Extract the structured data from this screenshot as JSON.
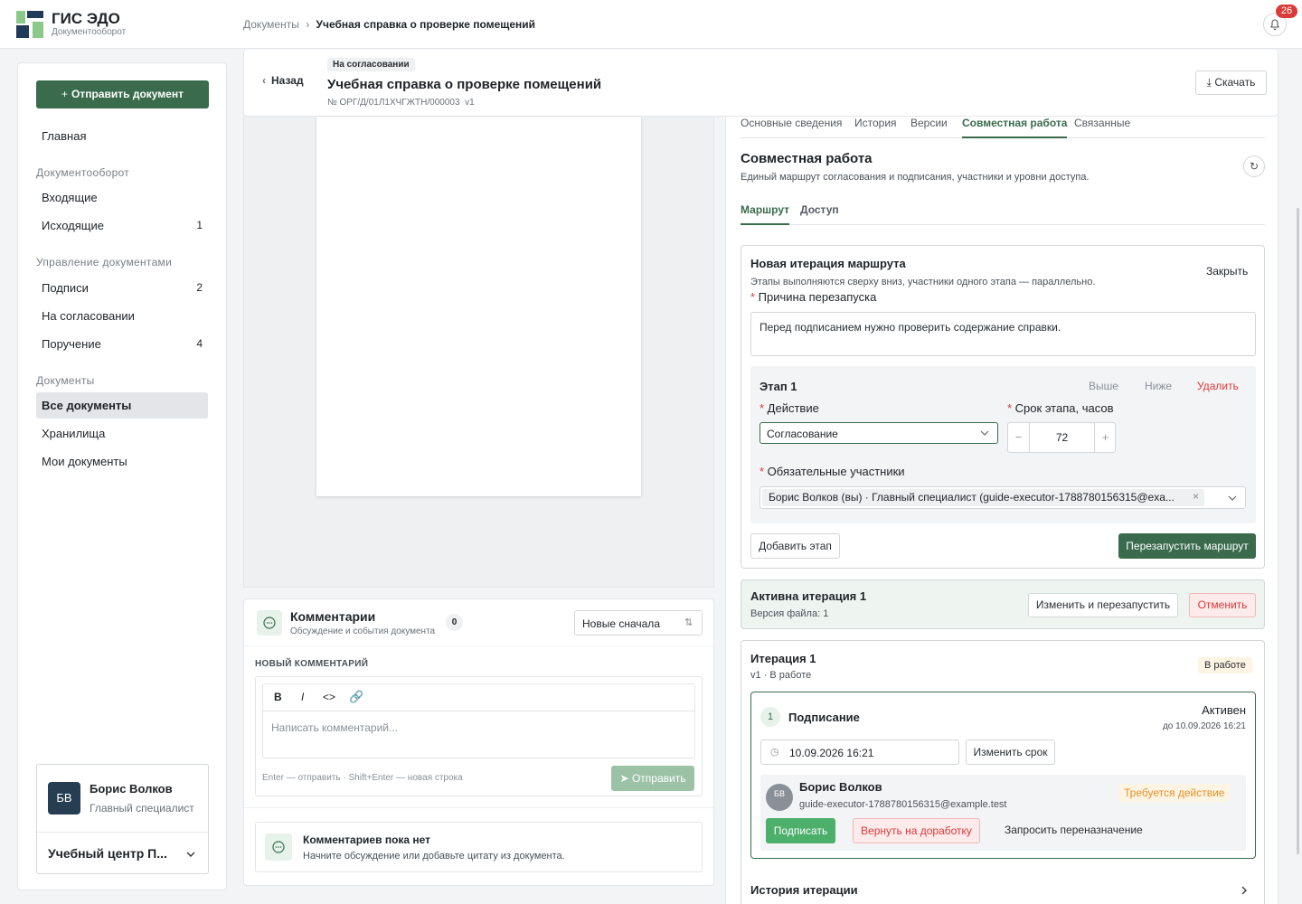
{
  "app": {
    "name": "ГИС ЭДО",
    "subtitle": "Документооборот"
  },
  "breadcrumb": {
    "root": "Документы",
    "separator": "›",
    "current": "Учебная справка о проверке помещений"
  },
  "notifications": {
    "count": "26"
  },
  "sidebar": {
    "send_button": "Отправить документ",
    "home": "Главная",
    "sections": [
      {
        "title": "Документооборот",
        "items": [
          {
            "label": "Входящие",
            "count": ""
          },
          {
            "label": "Исходящие",
            "count": "1"
          }
        ]
      },
      {
        "title": "Управление документами",
        "items": [
          {
            "label": "Подписи",
            "count": "2"
          },
          {
            "label": "На согласовании",
            "count": ""
          },
          {
            "label": "Поручение",
            "count": "4"
          }
        ]
      },
      {
        "title": "Документы",
        "items": [
          {
            "label": "Все документы",
            "count": ""
          },
          {
            "label": "Хранилища",
            "count": ""
          },
          {
            "label": "Мои документы",
            "count": ""
          }
        ]
      }
    ],
    "user": {
      "initials": "БВ",
      "name": "Борис Волков",
      "role": "Главный специалист"
    },
    "org": "Учебный центр П..."
  },
  "doc": {
    "back": "Назад",
    "status_badge": "На согласовании",
    "title": "Учебная справка о проверке помещений",
    "number": "№ ОРГ/Д/01Л1ХЧГЖТН/000003",
    "version": "v1",
    "download": "Скачать"
  },
  "tabs": [
    "Основные сведения",
    "История",
    "Версии",
    "Совместная работа",
    "Связанные"
  ],
  "collab": {
    "title": "Совместная работа",
    "desc": "Единый маршрут согласования и подписания, участники и уровни доступа.",
    "subtabs": [
      "Маршрут",
      "Доступ"
    ],
    "new_iter": {
      "title": "Новая итерация маршрута",
      "close": "Закрыть",
      "hint": "Этапы выполняются сверху вниз, участники одного этапа — параллельно.",
      "reason_label": "Причина перезапуска",
      "reason_value": "Перед подписанием нужно проверить содержание справки.",
      "stage_title": "Этап 1",
      "up": "Выше",
      "down": "Ниже",
      "delete": "Удалить",
      "action_label": "Действие",
      "action_value": "Согласование",
      "deadline_label": "Срок этапа, часов",
      "deadline_value": "72",
      "participants_label": "Обязательные участники",
      "participant": "Борис Волков (вы) · Главный специалист (guide-executor-1788780156315@exa...",
      "add_stage": "Добавить этап",
      "restart": "Перезапустить маршрут"
    },
    "active": {
      "title": "Активна итерация 1",
      "file_version": "Версия файла: 1",
      "edit_restart": "Изменить и перезапустить",
      "cancel": "Отменить"
    },
    "iteration": {
      "title": "Итерация 1",
      "sub": "v1 · В работе",
      "badge": "В работе",
      "step_num": "1",
      "step_title": "Подписание",
      "step_status": "Активен",
      "step_due": "до 10.09.2026 16:21",
      "date_value": "10.09.2026 16:21",
      "change_deadline": "Изменить срок",
      "assignee_initials": "БВ",
      "assignee_name": "Борис Волков",
      "assignee_email": "guide-executor-1788780156315@example.test",
      "action_required": "Требуется действие",
      "sign": "Подписать",
      "return": "Вернуть на доработку",
      "reassign": "Запросить переназначение"
    },
    "history": "История итерации"
  },
  "comments": {
    "title": "Комментарии",
    "subtitle": "Обсуждение и события документа",
    "count": "0",
    "sort": "Новые сначала",
    "new_label": "НОВЫЙ КОММЕНТАРИЙ",
    "placeholder": "Написать комментарий...",
    "hint": "Enter — отправить · Shift+Enter — новая строка",
    "send": "Отправить",
    "empty_title": "Комментариев пока нет",
    "empty_desc": "Начните обсуждение или добавьте цитату из документа."
  },
  "colors": {
    "primary": "#3a6b4c",
    "danger": "#d93a3a",
    "warning": "#e8902a"
  }
}
